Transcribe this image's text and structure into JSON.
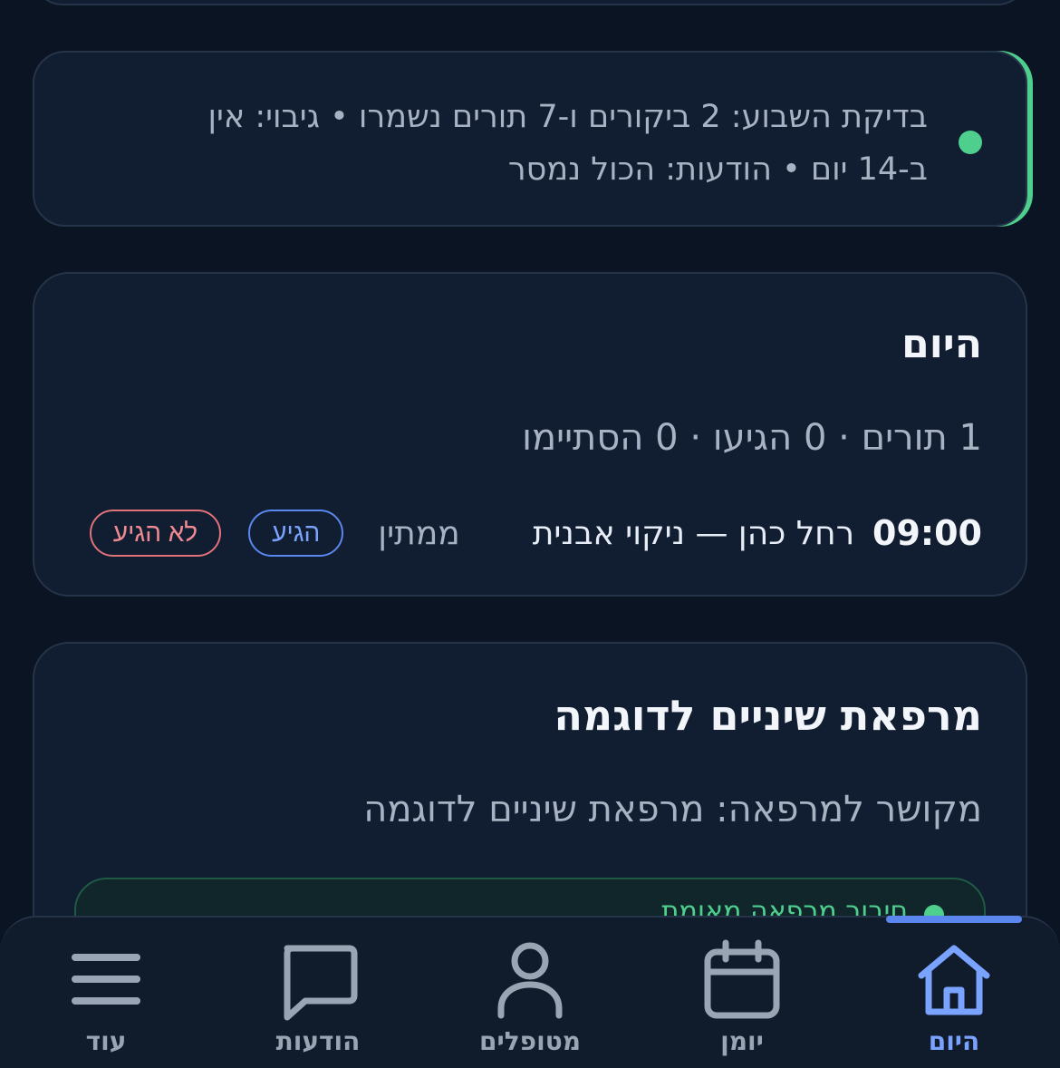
{
  "status": {
    "text": "בדיקת השבוע: 2 ביקורים ו-7 תורים נשמרו • גיבוי: אין ב-14 יום • הודעות: הכול נמסר",
    "dot_color": "#4fcf8e"
  },
  "today": {
    "title": "היום",
    "summary": "1 תורים · 0 הגיעו · 0 הסתיימו",
    "appointment": {
      "time": "09:00",
      "description": "רחל כהן — ניקוי אבנית",
      "state": "ממתין",
      "arrived_label": "הגיע",
      "no_show_label": "לא הגיע"
    }
  },
  "clinic": {
    "title": "מרפאת שיניים לדוגמה",
    "linked_text": "מקושר למרפאה: מרפאת שיניים לדוגמה",
    "inner_status": "חיבור מרפאה מאומת"
  },
  "nav": {
    "items": [
      {
        "label": "היום",
        "icon": "home-icon",
        "active": true
      },
      {
        "label": "יומן",
        "icon": "calendar-icon",
        "active": false
      },
      {
        "label": "מטופלים",
        "icon": "person-icon",
        "active": false
      },
      {
        "label": "הודעות",
        "icon": "message-icon",
        "active": false
      },
      {
        "label": "עוד",
        "icon": "menu-icon",
        "active": false
      }
    ],
    "active_color": "#7aa2ff",
    "inactive_color": "#9aa5b4"
  }
}
